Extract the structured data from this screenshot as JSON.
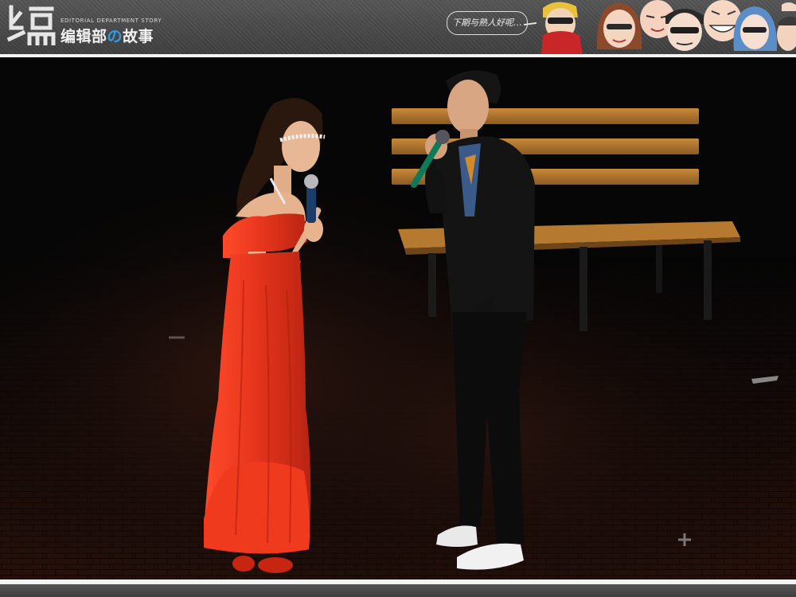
{
  "header": {
    "logo_subtitle": "EDITORIAL DEPARTMENT STORY",
    "logo_title_part1": "编辑部",
    "logo_title_accent": "の",
    "logo_title_part2": "故事",
    "speech_bubble_text": "下期与熟人好呢…",
    "accent_color": "#2f9be6"
  },
  "photo": {
    "icon": "stage-photo",
    "dress_color": "#e4341c"
  }
}
